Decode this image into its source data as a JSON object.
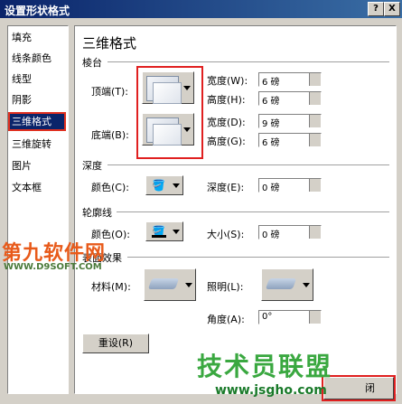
{
  "window": {
    "title": "设置形状格式",
    "help_btn": "?",
    "close_btn": "X"
  },
  "sidebar": {
    "items": [
      "填充",
      "线条颜色",
      "线型",
      "阴影",
      "三维格式",
      "三维旋转",
      "图片",
      "文本框"
    ],
    "selected_index": 4
  },
  "panel": {
    "title": "三维格式",
    "bevel": {
      "section": "棱台",
      "top_label": "顶端(T):",
      "bottom_label": "底端(B):",
      "top_width_label": "宽度(W):",
      "top_width_value": "6 磅",
      "top_height_label": "高度(H):",
      "top_height_value": "6 磅",
      "bottom_width_label": "宽度(D):",
      "bottom_width_value": "9 磅",
      "bottom_height_label": "高度(G):",
      "bottom_height_value": "6 磅"
    },
    "depth": {
      "section": "深度",
      "color_label": "颜色(C):",
      "depth_label": "深度(E):",
      "depth_value": "0 磅"
    },
    "contour": {
      "section": "轮廓线",
      "color_label": "颜色(O):",
      "size_label": "大小(S):",
      "size_value": "0 磅"
    },
    "surface": {
      "section": "表面效果",
      "material_label": "材料(M):",
      "lighting_label": "照明(L):",
      "angle_label": "角度(A):",
      "angle_value": "0°"
    },
    "reset_button": "重设(R)"
  },
  "footer": {
    "close_button": "闭"
  },
  "watermarks": {
    "brand_top": "第九软件网",
    "brand_top_url": "WWW.D9SOFT.COM",
    "brand_bottom": "技术员联盟",
    "brand_bottom_url": "www.jsgho.com"
  },
  "colors": {
    "titlebar": "#0a246a",
    "selection": "#0a246a",
    "highlight": "#e02020"
  }
}
